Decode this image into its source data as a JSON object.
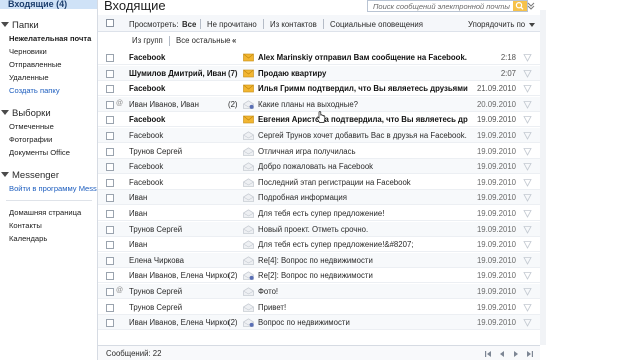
{
  "sidebar": {
    "selected_folder": "Входящие (4)",
    "folders_title": "Папки",
    "folders": [
      {
        "label": "Нежелательная почта",
        "style": "bold"
      },
      {
        "label": "Черновики",
        "style": "normal"
      },
      {
        "label": "Отправленные",
        "style": "normal"
      },
      {
        "label": "Удаленные",
        "style": "normal"
      },
      {
        "label": "Создать папку",
        "style": "link"
      }
    ],
    "views_title": "Выборки",
    "views": [
      {
        "label": "Отмеченные",
        "style": "normal"
      },
      {
        "label": "Фотографии",
        "style": "normal"
      },
      {
        "label": "Документы Office",
        "style": "normal"
      }
    ],
    "messenger_title": "Messenger",
    "messenger_link": "Войти в программу Messenger",
    "bottom_links": [
      "Домашняя страница",
      "Контакты",
      "Календарь"
    ]
  },
  "header": {
    "title": "Входящие",
    "search_placeholder": "Поиск сообщений электронной почты"
  },
  "toolbar": {
    "view_label": "Просмотреть:",
    "filters": [
      {
        "label": "Все",
        "active": true
      },
      {
        "label": "Не прочитано",
        "active": false
      },
      {
        "label": "Из контактов",
        "active": false
      },
      {
        "label": "Социальные оповещения",
        "active": false
      }
    ],
    "sort_label": "Упорядочить по"
  },
  "subtoolbar": {
    "from_groups": "Из групп",
    "others": "Все остальные",
    "collapse": "«"
  },
  "messages": [
    {
      "sender": "Facebook",
      "count": "",
      "subject": "Alex Marinskiy отправил Вам сообщение на Facebook.",
      "date": "2:18",
      "unread": true,
      "attach": false,
      "icon": "closed"
    },
    {
      "sender": "Шумилов Дмитрий, Иван",
      "count": "(7)",
      "subject": "Продаю квартиру",
      "date": "2:07",
      "unread": true,
      "attach": false,
      "icon": "closed"
    },
    {
      "sender": "Facebook",
      "count": "",
      "subject": "Илья Гримм подтвердил, что Вы являетесь друзьями",
      "date": "21.09.2010",
      "unread": true,
      "attach": false,
      "icon": "closed"
    },
    {
      "sender": "Иван Иванов, Иван",
      "count": "(2)",
      "subject": "Какие планы на выходные?",
      "date": "20.09.2010",
      "unread": false,
      "attach": true,
      "icon": "open-group"
    },
    {
      "sender": "Facebook",
      "count": "",
      "subject": "Евгения Аристова подтвердила, что Вы являетесь др",
      "date": "19.09.2010",
      "unread": true,
      "attach": false,
      "icon": "closed"
    },
    {
      "sender": "Facebook",
      "count": "",
      "subject": "Сергей Трунов хочет добавить Вас в друзья на Facebook.",
      "date": "19.09.2010",
      "unread": false,
      "attach": false,
      "icon": "open"
    },
    {
      "sender": "Трунов Сергей",
      "count": "",
      "subject": "Отличная игра получилась",
      "date": "19.09.2010",
      "unread": false,
      "attach": false,
      "icon": "open"
    },
    {
      "sender": "Facebook",
      "count": "",
      "subject": "Добро пожаловать на Facebook",
      "date": "19.09.2010",
      "unread": false,
      "attach": false,
      "icon": "open"
    },
    {
      "sender": "Facebook",
      "count": "",
      "subject": "Последний этап регистрации на Facebook",
      "date": "19.09.2010",
      "unread": false,
      "attach": false,
      "icon": "open"
    },
    {
      "sender": "Иван",
      "count": "",
      "subject": "Подробная информация",
      "date": "19.09.2010",
      "unread": false,
      "attach": false,
      "icon": "open"
    },
    {
      "sender": "Иван",
      "count": "",
      "subject": "Для тебя есть супер предложение!",
      "date": "19.09.2010",
      "unread": false,
      "attach": false,
      "icon": "open"
    },
    {
      "sender": "Трунов Сергей",
      "count": "",
      "subject": "Новый проект. Отметь срочно.",
      "date": "19.09.2010",
      "unread": false,
      "attach": false,
      "icon": "open"
    },
    {
      "sender": "Иван",
      "count": "",
      "subject": "Для тебя есть супер предложение!&#8207;",
      "date": "19.09.2010",
      "unread": false,
      "attach": false,
      "icon": "open"
    },
    {
      "sender": "Елена Чиркова",
      "count": "",
      "subject": "Re[4]: Вопрос по недвижимости",
      "date": "19.09.2010",
      "unread": false,
      "attach": false,
      "icon": "open"
    },
    {
      "sender": "Иван Иванов, Елена Чиркова",
      "count": "(2)",
      "subject": "Re[2]: Вопрос по недвижимости",
      "date": "19.09.2010",
      "unread": false,
      "attach": false,
      "icon": "open-group"
    },
    {
      "sender": "Трунов Сергей",
      "count": "",
      "subject": "Фото!",
      "date": "19.09.2010",
      "unread": false,
      "attach": true,
      "icon": "open"
    },
    {
      "sender": "Трунов Сергей",
      "count": "",
      "subject": "Привет!",
      "date": "19.09.2010",
      "unread": false,
      "attach": false,
      "icon": "open"
    },
    {
      "sender": "Иван Иванов, Елена Чиркова",
      "count": "(2)",
      "subject": "Вопрос по недвижимости",
      "date": "19.09.2010",
      "unread": false,
      "attach": false,
      "icon": "open-group"
    }
  ],
  "footer": {
    "count_text": "Сообщений: 22"
  },
  "colors": {
    "selected_bg": "#cfe2f7",
    "link": "#1f5fbf",
    "envelope_closed": "#f2b632",
    "envelope_open": "#c8cdd4"
  }
}
